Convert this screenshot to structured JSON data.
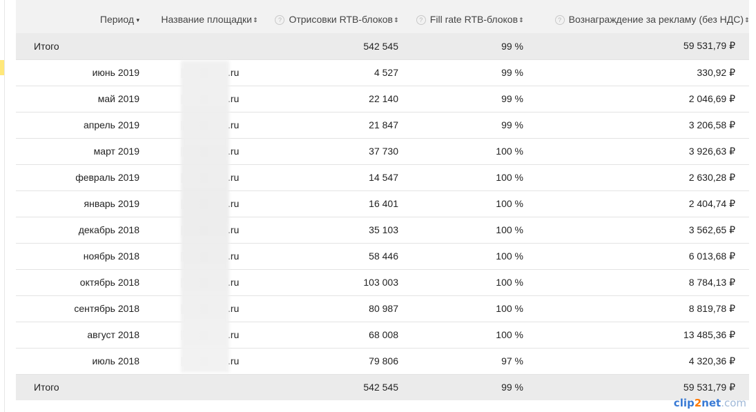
{
  "columns": {
    "period": "Период",
    "site": "Название площадки",
    "renders": "Отрисовки RTB-блоков",
    "fill_rate": "Fill rate RTB-блоков",
    "reward": "Вознаграждение за рекламу (без НДС)"
  },
  "icons": {
    "sort_down": "▾",
    "sort_both": "⇕",
    "help": "?"
  },
  "total_top": {
    "label": "Итого",
    "renders": "542 545",
    "fill_rate": "99 %",
    "reward": "59 531,79 ₽"
  },
  "rows": [
    {
      "period": "июнь 2019",
      "site": ".ru",
      "renders": "4 527",
      "fill_rate": "99 %",
      "reward": "330,92 ₽"
    },
    {
      "period": "май 2019",
      "site": ".ru",
      "renders": "22 140",
      "fill_rate": "99 %",
      "reward": "2 046,69 ₽"
    },
    {
      "period": "апрель 2019",
      "site": ".ru",
      "renders": "21 847",
      "fill_rate": "99 %",
      "reward": "3 206,58 ₽"
    },
    {
      "period": "март 2019",
      "site": ".ru",
      "renders": "37 730",
      "fill_rate": "100 %",
      "reward": "3 926,63 ₽"
    },
    {
      "period": "февраль 2019",
      "site": ".ru",
      "renders": "14 547",
      "fill_rate": "100 %",
      "reward": "2 630,28 ₽"
    },
    {
      "period": "январь 2019",
      "site": ".ru",
      "renders": "16 401",
      "fill_rate": "100 %",
      "reward": "2 404,74 ₽"
    },
    {
      "period": "декабрь 2018",
      "site": ".ru",
      "renders": "35 103",
      "fill_rate": "100 %",
      "reward": "3 562,65 ₽"
    },
    {
      "period": "ноябрь 2018",
      "site": ".ru",
      "renders": "58 446",
      "fill_rate": "100 %",
      "reward": "6 013,68 ₽"
    },
    {
      "period": "октябрь 2018",
      "site": ".ru",
      "renders": "103 003",
      "fill_rate": "100 %",
      "reward": "8 784,13 ₽"
    },
    {
      "period": "сентябрь 2018",
      "site": ".ru",
      "renders": "80 987",
      "fill_rate": "100 %",
      "reward": "8 819,78 ₽"
    },
    {
      "period": "август 2018",
      "site": ".ru",
      "renders": "68 008",
      "fill_rate": "100 %",
      "reward": "13 485,36 ₽"
    },
    {
      "period": "июль 2018",
      "site": ".ru",
      "renders": "79 806",
      "fill_rate": "97 %",
      "reward": "4 320,36 ₽"
    }
  ],
  "total_bottom": {
    "label": "Итого",
    "renders": "542 545",
    "fill_rate": "99 %",
    "reward": "59 531,79 ₽"
  },
  "watermark": {
    "part1": "clip",
    "part2": "2",
    "part3": "net",
    "part4": ".com"
  },
  "colors": {
    "header_bg": "#f2f2f2",
    "total_bg": "#ebebeb",
    "row_border": "#e3e3e3",
    "marker": "#ffe87a"
  }
}
